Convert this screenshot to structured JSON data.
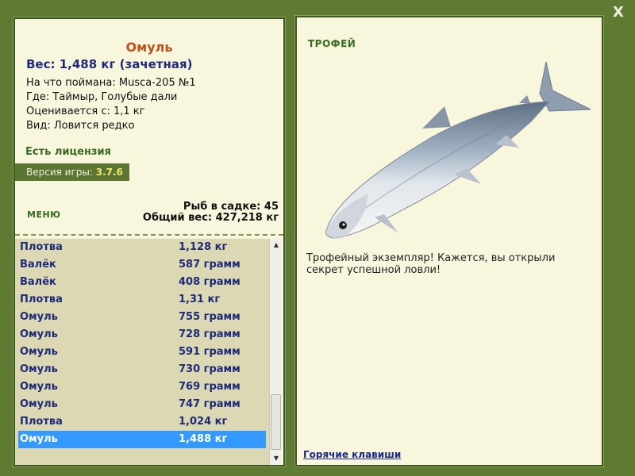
{
  "close_label": "X",
  "fish": {
    "name": "Омуль",
    "weight": "Вес: 1,488 кг (зачетная)",
    "caught_on": "На что поймана: Musca-205 №1",
    "location": "Где: Таймыр, Голубые дали",
    "rated_from": "Оценивается с: 1,1 кг",
    "species": "Вид: Ловится редко"
  },
  "license": "Есть лицензия",
  "version": {
    "label": "Версия игры:",
    "value": "3.7.6"
  },
  "menu_label": "МЕНЮ",
  "cage": {
    "count": "Рыб в садке: 45",
    "total": "Общий вес: 427,218 кг"
  },
  "catch_list": [
    {
      "name": "Плотва",
      "weight": "1,128 кг"
    },
    {
      "name": "Валёк",
      "weight": "587 грамм"
    },
    {
      "name": "Валёк",
      "weight": "408 грамм"
    },
    {
      "name": "Плотва",
      "weight": "1,31 кг"
    },
    {
      "name": "Омуль",
      "weight": "755 грамм"
    },
    {
      "name": "Омуль",
      "weight": "728 грамм"
    },
    {
      "name": "Омуль",
      "weight": "591 грамм"
    },
    {
      "name": "Омуль",
      "weight": "730 грамм"
    },
    {
      "name": "Омуль",
      "weight": "769 грамм"
    },
    {
      "name": "Омуль",
      "weight": "747 грамм"
    },
    {
      "name": "Плотва",
      "weight": "1,024 кг"
    },
    {
      "name": "Омуль",
      "weight": "1,488 кг",
      "selected": true
    }
  ],
  "trophy": {
    "title": "ТРОФЕЙ",
    "text": "Трофейный экземпляр! Кажется, вы открыли секрет успешной ловли!"
  },
  "hotkeys_label": "Горячие клавиши",
  "colors": {
    "background": "#5f7a33",
    "panel": "#f8f6dd",
    "selection": "#3399ff"
  }
}
